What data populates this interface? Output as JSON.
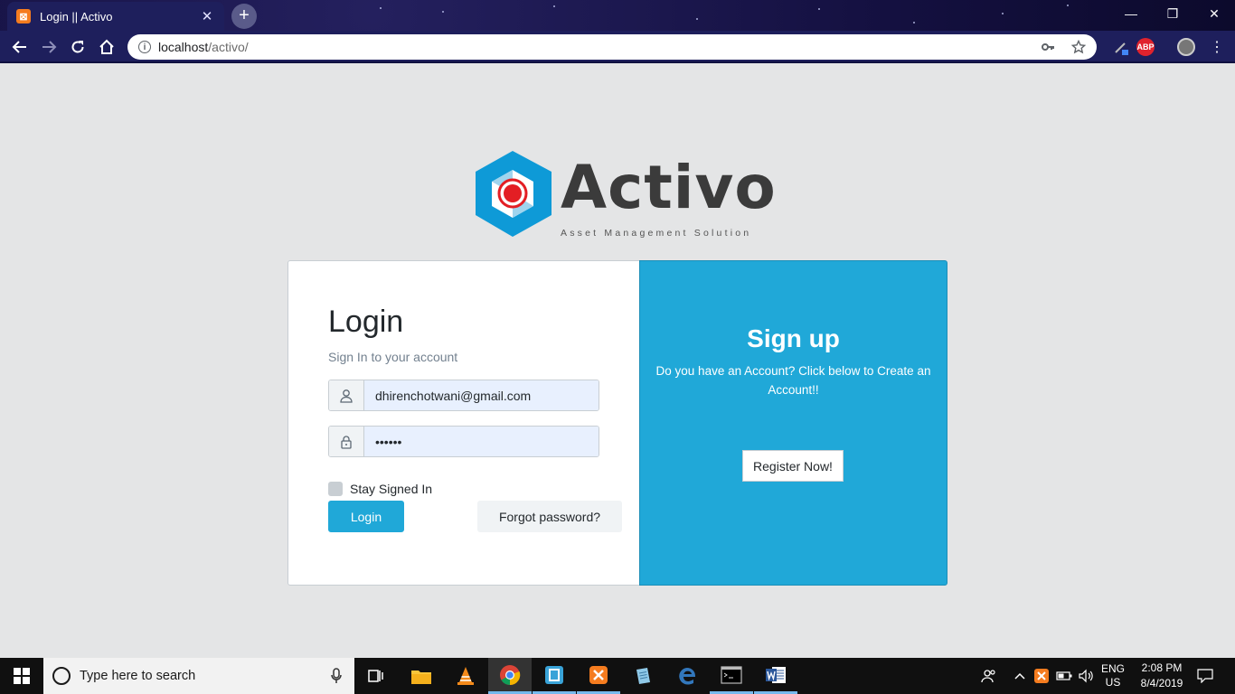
{
  "browser": {
    "tab_title": "Login || Activo",
    "tab_close": "✕",
    "new_tab": "+",
    "url_host": "localhost",
    "url_path": "/activo/",
    "ext_abp": "ABP",
    "window_minimize": "—",
    "window_restore": "❐",
    "window_close": "✕"
  },
  "logo": {
    "word": "Activo",
    "tagline": "Asset Management Solution"
  },
  "login": {
    "title": "Login",
    "subtitle": "Sign In to your account",
    "email_value": "dhirenchotwani@gmail.com",
    "password_value": "••••••",
    "stay_signed_in": "Stay Signed In",
    "login_button": "Login",
    "forgot_button": "Forgot password?"
  },
  "signup": {
    "title": "Sign up",
    "text": "Do you have an Account? Click below to Create an Account!!",
    "register_button": "Register Now!"
  },
  "taskbar": {
    "search_placeholder": "Type here to search",
    "lang_top": "ENG",
    "lang_bottom": "US",
    "time": "2:08 PM",
    "date": "8/4/2019"
  },
  "colors": {
    "primary": "#20a8d8",
    "logo_blue": "#0e9ad7",
    "logo_red": "#e31e24"
  }
}
